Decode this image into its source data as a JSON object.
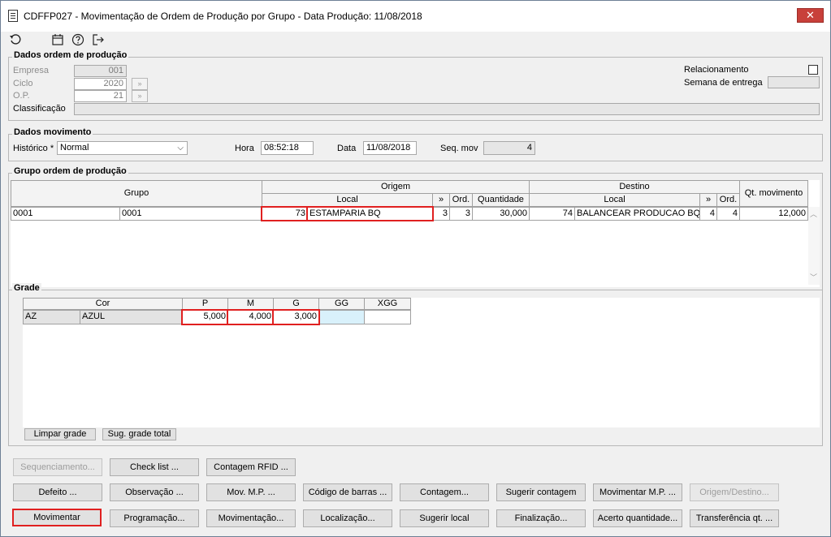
{
  "window": {
    "title": "CDFFP027 - Movimentação de Ordem de Produção por Grupo - Data Produção: 11/08/2018",
    "close_symbol": "✕"
  },
  "toolbar": {
    "icons": [
      "refresh-icon",
      "calendar-icon",
      "help-icon",
      "exit-icon"
    ]
  },
  "dados_ordem": {
    "legend": "Dados ordem de produção",
    "empresa_label": "Empresa",
    "empresa_value": "001",
    "ciclo_label": "Ciclo",
    "ciclo_value": "2020",
    "op_label": "O.P.",
    "op_value": "21",
    "classificacao_label": "Classificação",
    "classificacao_value": "",
    "relacionamento_label": "Relacionamento",
    "semana_label": "Semana de entrega",
    "semana_value": "",
    "lookup_symbol": "»"
  },
  "dados_movimento": {
    "legend": "Dados movimento",
    "historico_label": "Histórico *",
    "historico_value": "Normal",
    "hora_label": "Hora",
    "hora_value": "08:52:18",
    "data_label": "Data",
    "data_value": "11/08/2018",
    "seq_label": "Seq. mov",
    "seq_value": "4"
  },
  "grupo_ordem": {
    "legend": "Grupo ordem de produção",
    "headers": {
      "grupo": "Grupo",
      "origem": "Origem",
      "destino": "Destino",
      "local": "Local",
      "arrow": "»",
      "ord": "Ord.",
      "quantidade": "Quantidade",
      "qt_movimento": "Qt. movimento"
    },
    "row": {
      "c1": "0001",
      "c2": "0001",
      "orig_local_num": "73",
      "orig_local_name": "ESTAMPARIA BQ",
      "orig_arrow": "3",
      "orig_ord": "3",
      "orig_qtd": "30,000",
      "dest_local_num": "74",
      "dest_local_name": "BALANCEAR PRODUCAO BQ",
      "dest_arrow": "4",
      "dest_ord": "4",
      "qt_movimento": "12,000"
    }
  },
  "grade": {
    "legend": "Grade",
    "headers": {
      "cor": "Cor",
      "p": "P",
      "m": "M",
      "g": "G",
      "gg": "GG",
      "xgg": "XGG"
    },
    "row": {
      "code": "AZ",
      "name": "AZUL",
      "p": "5,000",
      "m": "4,000",
      "g": "3,000",
      "gg": "",
      "xgg": ""
    },
    "limpar_label": "Limpar grade",
    "sugerir_total_label": "Sug. grade total"
  },
  "buttons": {
    "row1": [
      "Sequenciamento...",
      "Check list ...",
      "Contagem RFID ..."
    ],
    "row2": [
      "Defeito ...",
      "Observação ...",
      "Mov. M.P. ...",
      "Código de barras ...",
      "Contagem...",
      "Sugerir contagem",
      "Movimentar M.P. ...",
      "Origem/Destino..."
    ],
    "row3": [
      "Movimentar",
      "Programação...",
      "Movimentação...",
      "Localização...",
      "Sugerir local",
      "Finalização...",
      "Acerto quantidade...",
      "Transferência qt. ..."
    ]
  },
  "colors": {
    "highlight": "#e02020",
    "selected_cell": "#d9f1fb"
  }
}
